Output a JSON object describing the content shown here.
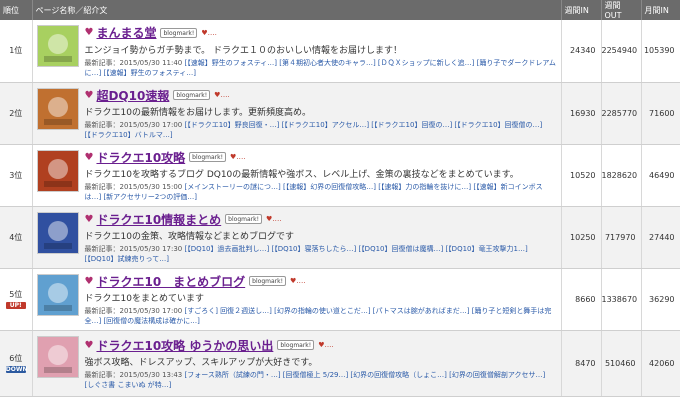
{
  "header": {
    "rank": "順位",
    "page": "ページ名称／紹介文",
    "week_in": "週間IN",
    "week_out": "週間OUT",
    "month_in": "月間IN"
  },
  "rows": [
    {
      "rank": "1位",
      "trend": "",
      "title": "まんまる堂",
      "blogmark": "blogmark!",
      "desc": "エンジョイ勢からガチ勢まで。 ドラクエ１０のおいしい情報をお届けします！",
      "latest_label": "最新記事：2015/05/30 11:40",
      "latest_links": "[【速報】野生のフォスティ…] [第４期初心者大使のキャラ…] [ＤＱＸショップに新しく追…] [踊り子でダークドレアムに…] [【速報】野生のフォスティ…]",
      "week_in": "24340",
      "week_out": "2254940",
      "month_in": "105390",
      "thumb_color": "#a8d060"
    },
    {
      "rank": "2位",
      "trend": "",
      "title": "超DQ10速報",
      "blogmark": "blogmark!",
      "desc": "ドラクエ10の最新情報をお届けします。更新頻度高め。",
      "latest_label": "最新記事：2015/05/30 17:00",
      "latest_links": "[【ドラクエ10】野良回復・…] [【ドラクエ10】アクセル…] [【ドラクエ10】回復の…] [【ドラクエ10】回復僧の…] [【ドラクエ10】バトルマ…]",
      "week_in": "16930",
      "week_out": "2285770",
      "month_in": "71600",
      "thumb_color": "#c07030"
    },
    {
      "rank": "3位",
      "trend": "",
      "title": "ドラクエ10攻略",
      "blogmark": "blogmark!",
      "desc": "ドラクエ10を攻略するブログ DQ10の最新情報や強ボス、レベル上げ、金策の裏技などをまとめています。",
      "latest_label": "最新記事：2015/05/30 15:00",
      "latest_links": "[メインストーリーの謎につ…] [【速報】幻界の回復僧攻略…] [【速報】力の指輪を抜けに…] [【速報】新コインボスは…] [新アクセサリー2つの評価…]",
      "week_in": "10520",
      "week_out": "1828620",
      "month_in": "46490",
      "thumb_color": "#b04020"
    },
    {
      "rank": "4位",
      "trend": "",
      "title": "ドラクエ10情報まとめ",
      "blogmark": "blogmark!",
      "desc": "ドラクエ10の金策、攻略情報などまとめブログです",
      "latest_label": "最新記事：2015/05/30 17:30",
      "latest_links": "[【DQ10】過去画批判し…] [【DQ10】寝落ちしたら…] [【DQ10】回復僧は魔構…] [【DQ10】竜王攻撃力1…] [【DQ10】試練売りって…]",
      "week_in": "10250",
      "week_out": "717970",
      "month_in": "27440",
      "thumb_color": "#3050a0"
    },
    {
      "rank": "5位",
      "trend": "UP!",
      "title": "ドラクエ10　まとめブログ",
      "blogmark": "blogmark!",
      "desc": "ドラクエ10をまとめています",
      "latest_label": "最新記事：2015/05/30 17:00",
      "latest_links": "[すごろく] 回復２週送し…] [幻界の指輪の使い道とこだ…] [パトマスは腕があればまだ…] [踊り子と短剣と舞手は完全…] [回復僧の魔法構成は確かに…]",
      "week_in": "8660",
      "week_out": "1338670",
      "month_in": "36290",
      "thumb_color": "#60a0d0"
    },
    {
      "rank": "6位",
      "trend": "DOWN",
      "title": "ドラクエ10攻略 ゆうかの思い出",
      "blogmark": "blogmark!",
      "desc": "強ボス攻略、ドレスアップ、スキルアップが大好きです。",
      "latest_label": "最新記事：2015/05/30 13:43",
      "latest_links": "[フォース熟所（試練の門・…] [回復僧極上 5/29…] [幻界の回復僧攻略（しょこ…] [幻界の回復僧解剖アクセサ…] [しぐさ書 こまいぬ が特…]",
      "week_in": "8470",
      "week_out": "510460",
      "month_in": "42060",
      "thumb_color": "#e0a0b0"
    }
  ]
}
